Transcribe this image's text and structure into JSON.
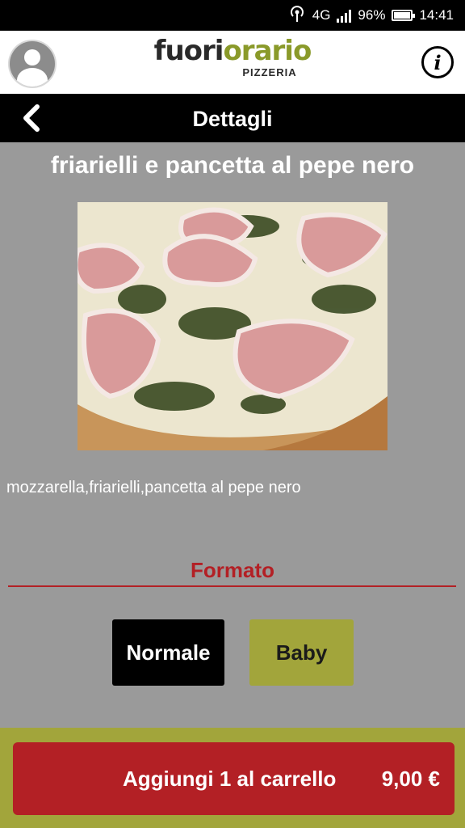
{
  "status_bar": {
    "network": "4G",
    "battery": "96%",
    "battery_level": 0.96,
    "time": "14:41"
  },
  "header": {
    "logo_part1": "fuori",
    "logo_part2": "orario",
    "logo_sub": "PIZZERIA",
    "info_label": "i"
  },
  "nav": {
    "title": "Dettagli"
  },
  "product": {
    "name": "friarielli e pancetta al pepe nero",
    "description": "mozzarella,friarielli,pancetta al pepe nero"
  },
  "format": {
    "title": "Formato",
    "options": [
      "Normale",
      "Baby"
    ],
    "selected": "Normale"
  },
  "cart": {
    "label": "Aggiungi 1 al carrello",
    "price": "9,00 €"
  },
  "colors": {
    "brand_green": "#a2a53b",
    "brand_red": "#b32025",
    "background_gray": "#9a9a9a"
  }
}
